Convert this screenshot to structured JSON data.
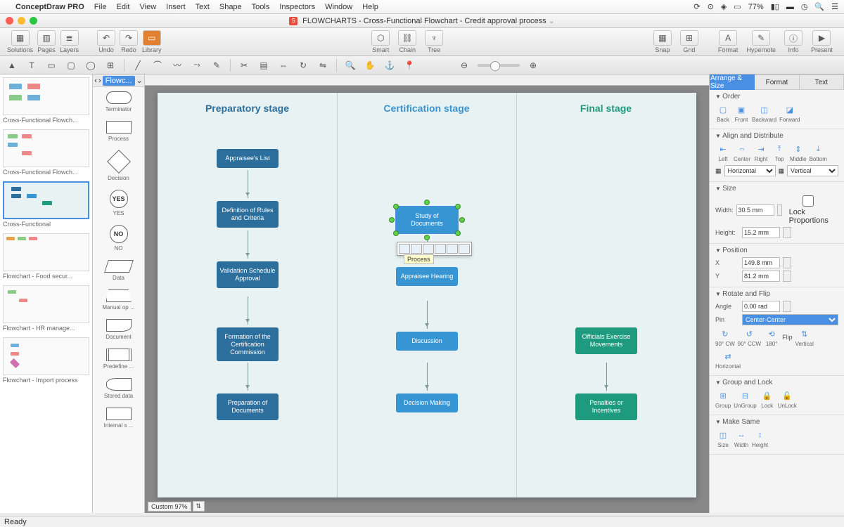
{
  "menubar": {
    "app": "ConceptDraw PRO",
    "items": [
      "File",
      "Edit",
      "View",
      "Insert",
      "Text",
      "Shape",
      "Tools",
      "Inspectors",
      "Window",
      "Help"
    ],
    "battery": "77%"
  },
  "window": {
    "doc_prefix": "FLOWCHARTS",
    "doc_title": "Cross-Functional Flowchart - Credit approval process"
  },
  "toolbar": {
    "groups_left": [
      {
        "label": "Solutions",
        "icons": [
          "▦"
        ]
      },
      {
        "label": "Pages",
        "icons": [
          "▥"
        ]
      },
      {
        "label": "Layers",
        "icons": [
          "≣"
        ]
      }
    ],
    "groups_left2": [
      {
        "label": "Undo",
        "icons": [
          "↶"
        ]
      },
      {
        "label": "Redo",
        "icons": [
          "↷"
        ]
      },
      {
        "label": "Library",
        "icons": [
          "▭"
        ]
      }
    ],
    "center": [
      {
        "label": "Smart",
        "icon": "⬡"
      },
      {
        "label": "Chain",
        "icon": "⛓"
      },
      {
        "label": "Tree",
        "icon": "♆"
      }
    ],
    "right": [
      {
        "label": "Snap",
        "icon": "▦"
      },
      {
        "label": "Grid",
        "icon": "⊞"
      },
      {
        "label": "Format",
        "icon": "Aᵢ"
      },
      {
        "label": "Hypernote",
        "icon": "✎"
      },
      {
        "label": "Info",
        "icon": "ⓘ"
      },
      {
        "label": "Present",
        "icon": "▶"
      }
    ]
  },
  "templates": [
    {
      "name": "Cross-Functional Flowch..."
    },
    {
      "name": "Cross-Functional Flowch..."
    },
    {
      "name": "Cross-Functional",
      "selected": true
    },
    {
      "name": "Flowchart - Food secur..."
    },
    {
      "name": "Flowchart - HR manage..."
    },
    {
      "name": "Flowchart - Import process"
    }
  ],
  "library": {
    "header": "Flowc...",
    "shapes": [
      {
        "label": "Terminator",
        "cls": "terminator"
      },
      {
        "label": "Process",
        "cls": ""
      },
      {
        "label": "Decision",
        "cls": "decision"
      },
      {
        "label": "YES",
        "cls": "yes",
        "text": "YES"
      },
      {
        "label": "NO",
        "cls": "yes",
        "text": "NO"
      },
      {
        "label": "Data",
        "cls": "data"
      },
      {
        "label": "Manual op ...",
        "cls": "manual"
      },
      {
        "label": "Document",
        "cls": "document"
      },
      {
        "label": "Predefine ...",
        "cls": "predef"
      },
      {
        "label": "Stored data",
        "cls": "stored"
      },
      {
        "label": "Internal s ...",
        "cls": "internal"
      }
    ]
  },
  "canvas": {
    "stages": [
      "Preparatory stage",
      "Certification stage",
      "Final stage"
    ],
    "nodes": {
      "n1": "Appraisee's List",
      "n2": "Definition of Rules and Criteria",
      "n3": "Validation Schedule Approval",
      "n4": "Formation of the Certification Commission",
      "n5": "Preparation of Documents",
      "n6": "Study of Documents",
      "n7": "Appraisee Hearing",
      "n8": "Discussion",
      "n9": "Decision Making",
      "n10": "Officials Exercise Movements",
      "n11": "Penalties or Incentives"
    },
    "popup_label": "Process",
    "zoom_label": "Custom 97%"
  },
  "inspector": {
    "tabs": [
      "Arrange & Size",
      "Format",
      "Text"
    ],
    "order": {
      "hdr": "Order",
      "items": [
        "Back",
        "Front",
        "Backward",
        "Forward"
      ]
    },
    "align": {
      "hdr": "Align and Distribute",
      "items": [
        "Left",
        "Center",
        "Right",
        "Top",
        "Middle",
        "Bottom"
      ],
      "hlabel": "Horizontal",
      "vlabel": "Vertical"
    },
    "size": {
      "hdr": "Size",
      "width_label": "Width:",
      "width_val": "30.5 mm",
      "height_label": "Height:",
      "height_val": "15.2 mm",
      "lock": "Lock Proportions"
    },
    "position": {
      "hdr": "Position",
      "x_label": "X",
      "x_val": "149.8 mm",
      "y_label": "Y",
      "y_val": "81.2 mm"
    },
    "rotate": {
      "hdr": "Rotate and Flip",
      "angle_label": "Angle",
      "angle_val": "0.00 rad",
      "pin_label": "Pin",
      "pin_val": "Center-Center",
      "items": [
        "90° CW",
        "90° CCW",
        "180°"
      ],
      "flip": "Flip",
      "flip_items": [
        "Vertical",
        "Horizontal"
      ]
    },
    "group": {
      "hdr": "Group and Lock",
      "items": [
        "Group",
        "UnGroup",
        "Lock",
        "UnLock"
      ]
    },
    "makesame": {
      "hdr": "Make Same",
      "items": [
        "Size",
        "Width",
        "Height"
      ]
    }
  },
  "status": {
    "ready": "Ready"
  }
}
